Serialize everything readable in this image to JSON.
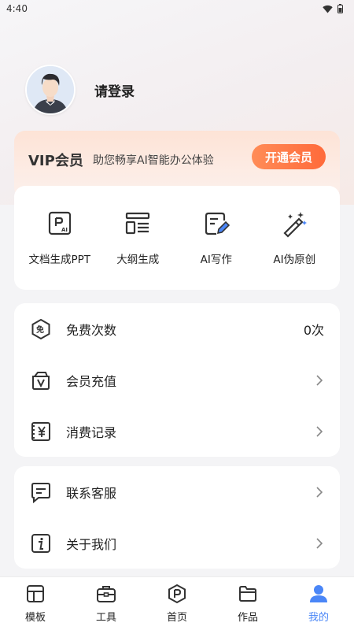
{
  "status_bar": {
    "time": "4:40"
  },
  "profile": {
    "login_prompt": "请登录"
  },
  "vip": {
    "title": "VIP会员",
    "subtitle": "助您畅享AI智能办公体验",
    "button": "开通会员"
  },
  "tools": [
    {
      "label": "文档生成PPT",
      "icon": "ppt-ai-icon"
    },
    {
      "label": "大纲生成",
      "icon": "outline-icon"
    },
    {
      "label": "AI写作",
      "icon": "ai-writing-icon"
    },
    {
      "label": "AI伪原创",
      "icon": "magic-wand-icon"
    }
  ],
  "menu_1": [
    {
      "label": "免费次数",
      "value": "0次",
      "icon": "free-badge-icon"
    },
    {
      "label": "会员充值",
      "icon": "vip-bag-icon"
    },
    {
      "label": "消费记录",
      "icon": "yen-receipt-icon"
    }
  ],
  "menu_2": [
    {
      "label": "联系客服",
      "icon": "message-icon"
    },
    {
      "label": "关于我们",
      "icon": "info-icon"
    }
  ],
  "tabbar": {
    "items": [
      {
        "label": "模板",
        "icon": "template-icon"
      },
      {
        "label": "工具",
        "icon": "toolbox-icon"
      },
      {
        "label": "首页",
        "icon": "home-p-icon"
      },
      {
        "label": "作品",
        "icon": "folder-icon"
      },
      {
        "label": "我的",
        "icon": "user-icon"
      }
    ],
    "active_index": 4
  },
  "colors": {
    "accent": "#4a86f7",
    "vip_button_start": "#ff8c57",
    "vip_button_end": "#ff6a3a",
    "icon_stroke": "#333333"
  }
}
